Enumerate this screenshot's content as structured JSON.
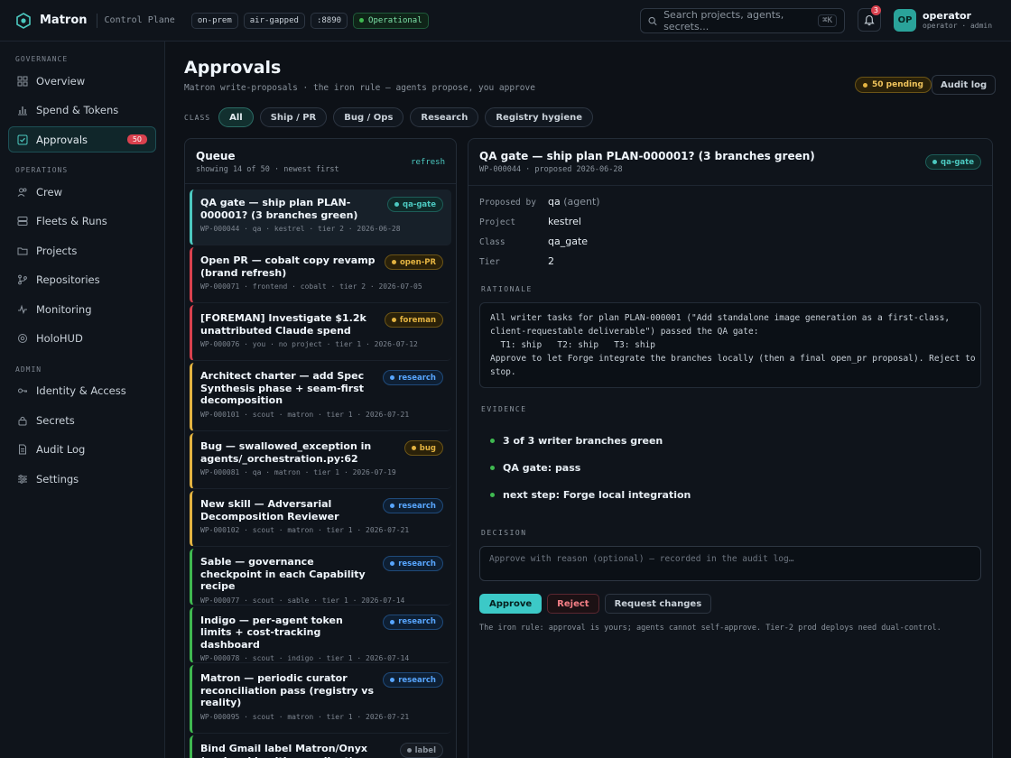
{
  "app": {
    "brand": "Matron",
    "subtitle": "Control Plane",
    "pills": [
      "on-prem",
      "air-gapped",
      ":8890"
    ],
    "status": "Operational"
  },
  "search": {
    "placeholder": "Search projects, agents, secrets...",
    "shortcut": "⌘K"
  },
  "notifications": {
    "count": "3"
  },
  "user": {
    "initials": "OP",
    "name": "operator",
    "role": "operator · admin"
  },
  "sidebar": {
    "sections": [
      {
        "label": "GOVERNANCE",
        "items": [
          {
            "label": "Overview",
            "icon": "grid-icon"
          },
          {
            "label": "Spend & Tokens",
            "icon": "bar-chart-icon"
          },
          {
            "label": "Approvals",
            "icon": "check-square-icon",
            "count": "50",
            "active": true
          }
        ]
      },
      {
        "label": "OPERATIONS",
        "items": [
          {
            "label": "Crew",
            "icon": "users-icon"
          },
          {
            "label": "Fleets & Runs",
            "icon": "server-icon"
          },
          {
            "label": "Projects",
            "icon": "folder-icon"
          },
          {
            "label": "Repositories",
            "icon": "git-branch-icon"
          },
          {
            "label": "Monitoring",
            "icon": "activity-icon"
          },
          {
            "label": "HoloHUD",
            "icon": "target-icon"
          }
        ]
      },
      {
        "label": "ADMIN",
        "items": [
          {
            "label": "Identity & Access",
            "icon": "key-icon"
          },
          {
            "label": "Secrets",
            "icon": "lock-icon"
          },
          {
            "label": "Audit Log",
            "icon": "file-icon"
          },
          {
            "label": "Settings",
            "icon": "sliders-icon"
          }
        ]
      }
    ]
  },
  "page": {
    "title": "Approvals",
    "subtitle": "Matron write-proposals · the iron rule — agents propose, you approve",
    "pending": "50 pending",
    "audit_label": "Audit log",
    "class_label": "CLASS",
    "filters": [
      {
        "label": "All",
        "active": true
      },
      {
        "label": "Ship / PR"
      },
      {
        "label": "Bug / Ops"
      },
      {
        "label": "Research"
      },
      {
        "label": "Registry hygiene"
      }
    ]
  },
  "queue": {
    "title": "Queue",
    "subtitle": "showing 14 of 50 · newest first",
    "refresh": "refresh",
    "items": [
      {
        "title": "QA gate — ship plan PLAN-000001? (3 branches green)",
        "meta": "WP-000044 · qa · kestrel · tier 2 · 2026-06-28",
        "tag": "qa-gate",
        "color": "#4cc9c0",
        "selected": true
      },
      {
        "title": "Open PR — cobalt copy revamp (brand refresh)",
        "meta": "WP-000071 · frontend · cobalt · tier 2 · 2026-07-05",
        "tag": "open-PR",
        "color": "#e3b341",
        "bar": "#d9414e"
      },
      {
        "title": "[FOREMAN] Investigate $1.2k unattributed Claude spend",
        "meta": "WP-000076 · you · no project · tier 1 · 2026-07-12",
        "tag": "foreman",
        "color": "#e3b341",
        "bar": "#d9414e"
      },
      {
        "title": "Architect charter — add Spec Synthesis phase + seam-first decomposition",
        "meta": "WP-000101 · scout · matron · tier 1 · 2026-07-21",
        "tag": "research",
        "color": "#58a6ff",
        "bar": "#e3b341"
      },
      {
        "title": "Bug — swallowed_exception in agents/_orchestration.py:62",
        "meta": "WP-000081 · qa · matron · tier 1 · 2026-07-19",
        "tag": "bug",
        "color": "#e3b341",
        "bar": "#e3b341"
      },
      {
        "title": "New skill — Adversarial Decomposition Reviewer",
        "meta": "WP-000102 · scout · matron · tier 1 · 2026-07-21",
        "tag": "research",
        "color": "#58a6ff",
        "bar": "#e3b341"
      },
      {
        "title": "Sable — governance checkpoint in each Capability recipe",
        "meta": "WP-000077 · scout · sable · tier 1 · 2026-07-14",
        "tag": "research",
        "color": "#58a6ff",
        "bar": "#3fb950"
      },
      {
        "title": "Indigo — per-agent token limits + cost-tracking dashboard",
        "meta": "WP-000078 · scout · indigo · tier 1 · 2026-07-14",
        "tag": "research",
        "color": "#58a6ff",
        "bar": "#3fb950"
      },
      {
        "title": "Matron — periodic curator reconciliation pass (registry vs reality)",
        "meta": "WP-000095 · scout · matron · tier 1 · 2026-07-21",
        "tag": "research",
        "color": "#58a6ff",
        "bar": "#3fb950"
      },
      {
        "title": "Bind Gmail label Matron/Onyx (regional healthcare client)",
        "meta": "",
        "tag": "label",
        "color": "#8b949e",
        "bar": "#3fb950"
      }
    ]
  },
  "detail": {
    "title": "QA gate — ship plan PLAN-000001? (3 branches green)",
    "subtitle": "WP-000044 · proposed 2026-06-28",
    "tag": "qa-gate",
    "fields": [
      {
        "key": "Proposed by",
        "value": "qa",
        "extra": "(agent)"
      },
      {
        "key": "Project",
        "value": "kestrel"
      },
      {
        "key": "Class",
        "value": "qa_gate"
      },
      {
        "key": "Tier",
        "value": "2"
      }
    ],
    "rationale_label": "RATIONALE",
    "rationale": "All writer tasks for plan PLAN-000001 (\"Add standalone image generation as a first-class,\nclient-requestable deliverable\") passed the QA gate:\n  T1: ship   T2: ship   T3: ship\nApprove to let Forge integrate the branches locally (then a final open_pr proposal). Reject to\nstop.",
    "evidence_label": "EVIDENCE",
    "evidence": [
      "3 of 3 writer branches green",
      "QA gate: pass",
      "next step: Forge local integration"
    ],
    "decision_label": "DECISION",
    "decision_placeholder": "Approve with reason (optional) — recorded in the audit log…",
    "approve": "Approve",
    "reject": "Reject",
    "request_changes": "Request changes",
    "footnote": "The iron rule: approval is yours; agents cannot self-approve. Tier-2 prod deploys need dual-control."
  }
}
